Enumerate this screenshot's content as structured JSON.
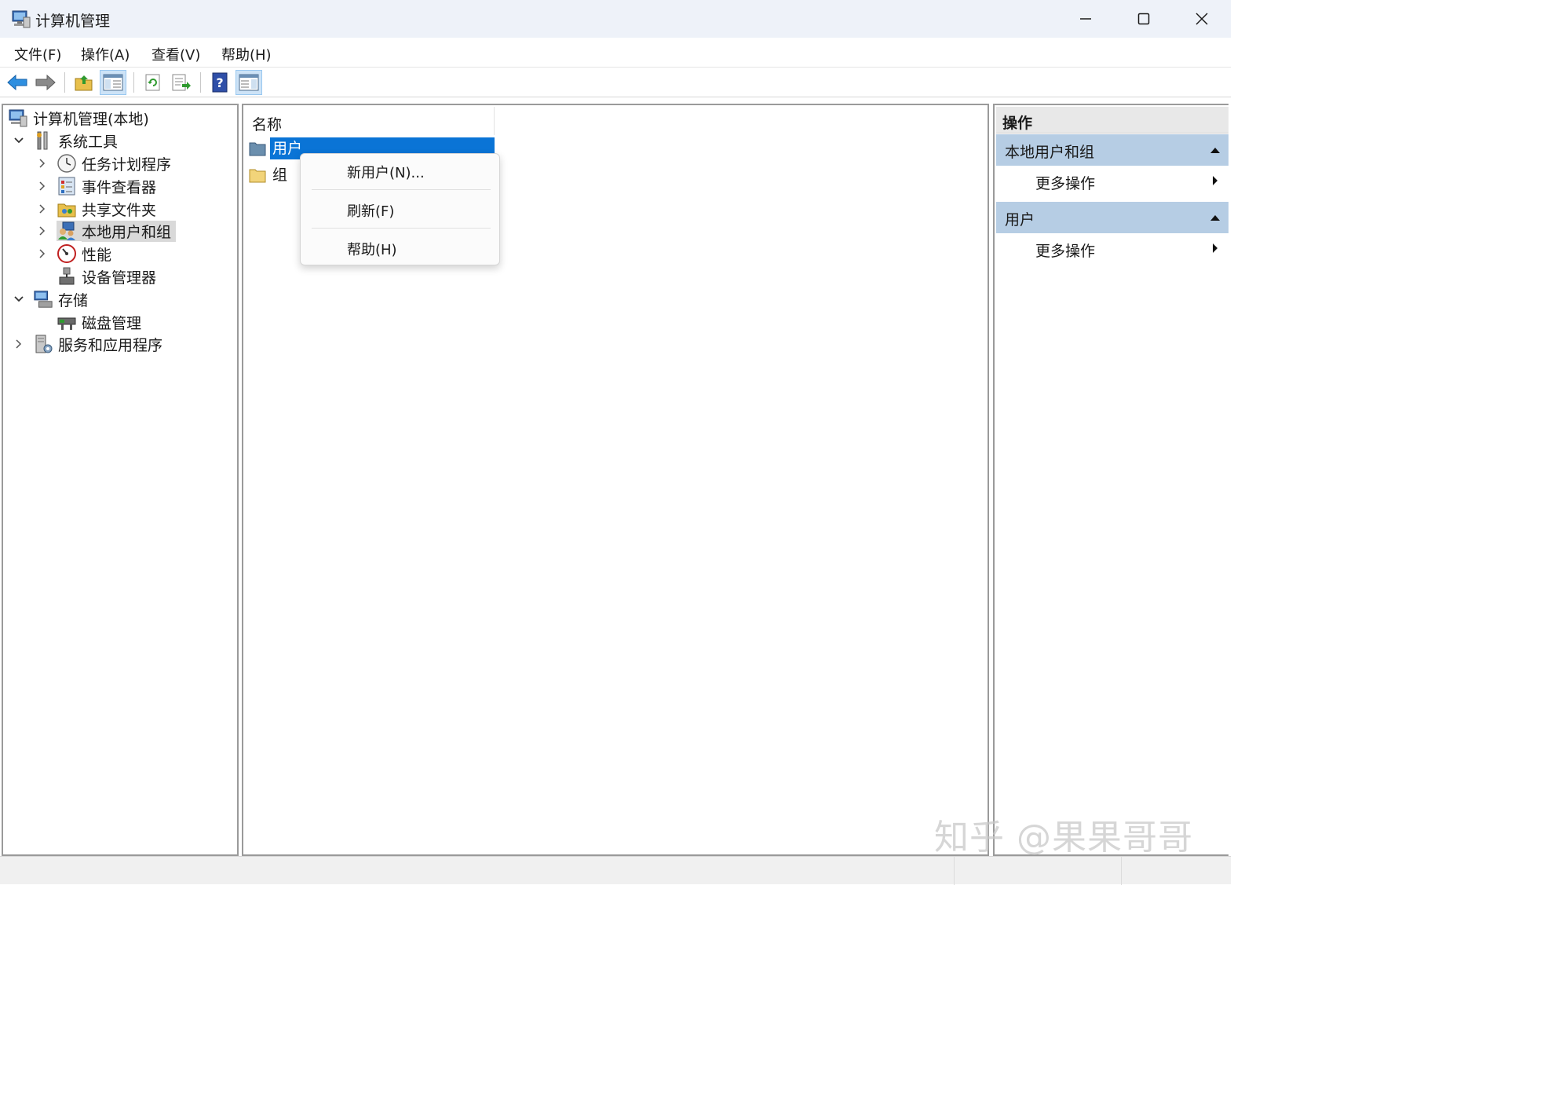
{
  "window": {
    "title": "计算机管理"
  },
  "menubar": {
    "items": [
      {
        "label": "文件(F)"
      },
      {
        "label": "操作(A)"
      },
      {
        "label": "查看(V)"
      },
      {
        "label": "帮助(H)"
      }
    ]
  },
  "toolbar": {
    "buttons": [
      "back-icon",
      "forward-icon",
      "up-folder-icon",
      "show-hide-tree-icon",
      "refresh-icon",
      "export-list-icon",
      "help-icon",
      "show-hide-action-pane-icon"
    ]
  },
  "tree": {
    "root": {
      "label": "计算机管理(本地)"
    },
    "system_tools": {
      "label": "系统工具"
    },
    "task_scheduler": {
      "label": "任务计划程序"
    },
    "event_viewer": {
      "label": "事件查看器"
    },
    "shared_folders": {
      "label": "共享文件夹"
    },
    "local_users": {
      "label": "本地用户和组"
    },
    "performance": {
      "label": "性能"
    },
    "device_manager": {
      "label": "设备管理器"
    },
    "storage": {
      "label": "存储"
    },
    "disk_management": {
      "label": "磁盘管理"
    },
    "services": {
      "label": "服务和应用程序"
    }
  },
  "list": {
    "column_header": "名称",
    "rows": [
      {
        "label": "用户"
      },
      {
        "label": "组"
      }
    ]
  },
  "context_menu": {
    "items": [
      {
        "label": "新用户(N)..."
      },
      {
        "label": "刷新(F)"
      },
      {
        "label": "帮助(H)"
      }
    ]
  },
  "actions": {
    "header": "操作",
    "groups": [
      {
        "title": "本地用户和组",
        "item": "更多操作"
      },
      {
        "title": "用户",
        "item": "更多操作"
      }
    ]
  },
  "watermark": {
    "text": "知乎 @果果哥哥"
  },
  "colors": {
    "selection": "#0a74d6",
    "action_group": "#b6cde4",
    "titlebar": "#eef2f9"
  }
}
